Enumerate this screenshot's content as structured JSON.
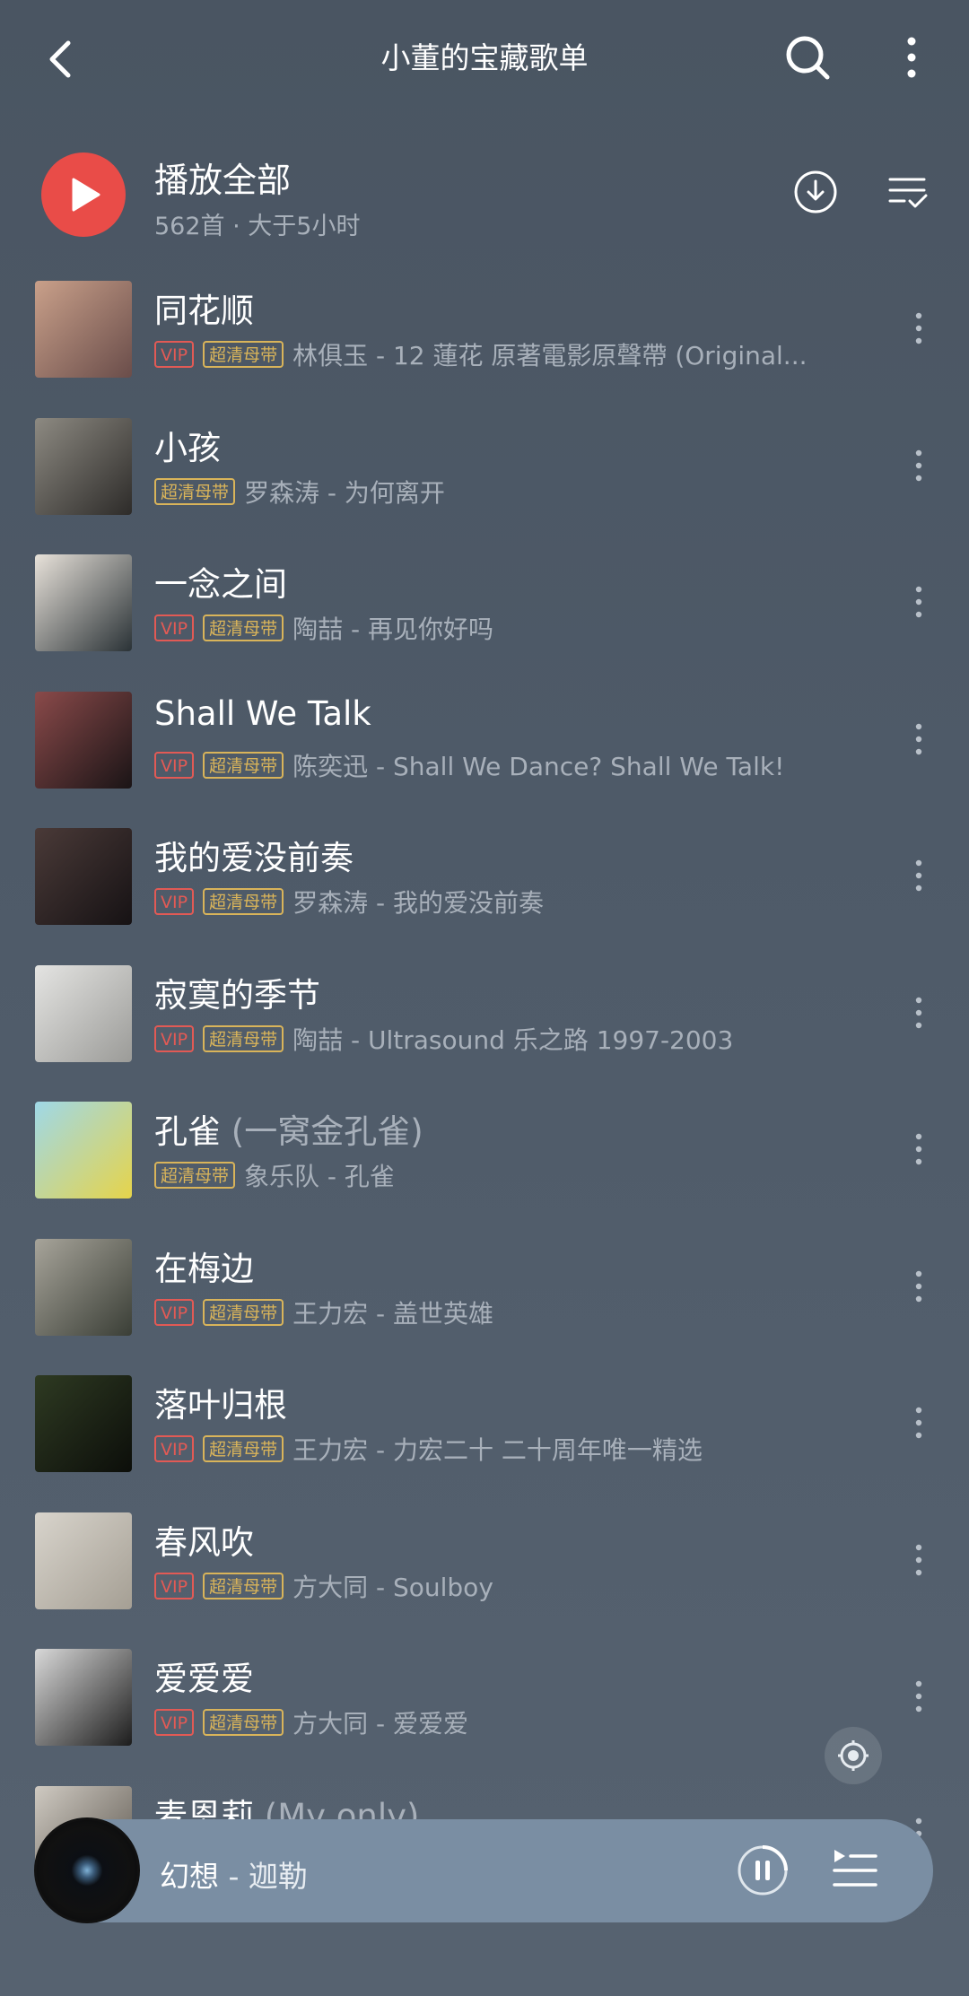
{
  "header": {
    "title": "小董的宝藏歌单"
  },
  "play_all": {
    "label": "播放全部",
    "subtitle": "562首 · 大于5小时"
  },
  "songs": [
    {
      "title": "同花顺",
      "extra": "",
      "vip": true,
      "hq": true,
      "meta": "林俱玉 - 12 蓮花 原著電影原聲帶 (Original...",
      "cover_colors": [
        "#c9a08a",
        "#6a4d4a"
      ]
    },
    {
      "title": "小孩",
      "extra": "",
      "vip": false,
      "hq": true,
      "meta": "罗森涛 - 为何离开",
      "cover_colors": [
        "#8d8a82",
        "#2d2b29"
      ]
    },
    {
      "title": "一念之间",
      "extra": "",
      "vip": true,
      "hq": true,
      "meta": "陶喆 - 再见你好吗",
      "cover_colors": [
        "#e8e2da",
        "#2a3236"
      ]
    },
    {
      "title": "Shall We Talk",
      "extra": "",
      "vip": true,
      "hq": true,
      "meta": "陈奕迅 - Shall We Dance? Shall We Talk!",
      "cover_colors": [
        "#8a4a4a",
        "#1a1416"
      ]
    },
    {
      "title": "我的爱没前奏",
      "extra": "",
      "vip": true,
      "hq": true,
      "meta": "罗森涛 - 我的爱没前奏",
      "cover_colors": [
        "#4a3a38",
        "#161214"
      ]
    },
    {
      "title": "寂寞的季节",
      "extra": "",
      "vip": true,
      "hq": true,
      "meta": "陶喆 - Ultrasound 乐之路 1997-2003",
      "cover_colors": [
        "#e4e4e2",
        "#9b9b98"
      ]
    },
    {
      "title": "孔雀",
      "extra": "(一窝金孔雀)",
      "vip": false,
      "hq": true,
      "meta": "象乐队 - 孔雀",
      "cover_colors": [
        "#9fd8e8",
        "#e6d44a"
      ]
    },
    {
      "title": "在梅边",
      "extra": "",
      "vip": true,
      "hq": true,
      "meta": "王力宏 - 盖世英雄",
      "cover_colors": [
        "#a7a49a",
        "#3a3e36"
      ]
    },
    {
      "title": "落叶归根",
      "extra": "",
      "vip": true,
      "hq": true,
      "meta": "王力宏 - 力宏二十 二十周年唯一精选",
      "cover_colors": [
        "#2e3a22",
        "#0c0e0a"
      ]
    },
    {
      "title": "春风吹",
      "extra": "",
      "vip": true,
      "hq": true,
      "meta": "方大同 - Soulboy",
      "cover_colors": [
        "#d8d4cc",
        "#a59f94"
      ]
    },
    {
      "title": "爱爱爱",
      "extra": "",
      "vip": true,
      "hq": true,
      "meta": "方大同 - 爱爱爱",
      "cover_colors": [
        "#d9d9d9",
        "#1c1c1c"
      ]
    },
    {
      "title": "麦恩莉",
      "extra": "(My only)",
      "vip": false,
      "hq": false,
      "meta": "",
      "cover_colors": [
        "#cfcac2",
        "#5a544c"
      ]
    }
  ],
  "tags": {
    "vip": "VIP",
    "hq": "超清母带"
  },
  "mini_player": {
    "title": "幻想",
    "artist": " - 迦勒"
  },
  "icons": {
    "back": "chevron-left-icon",
    "search": "search-icon",
    "more": "more-vertical-icon",
    "play": "play-icon",
    "download": "download-icon",
    "multiselect": "list-check-icon",
    "locate": "locate-icon",
    "pause": "pause-icon",
    "queue": "playlist-icon"
  },
  "colors": {
    "accent_red": "#e94c48",
    "vip": "#e25a55",
    "hq_gold": "#d9b45a"
  }
}
